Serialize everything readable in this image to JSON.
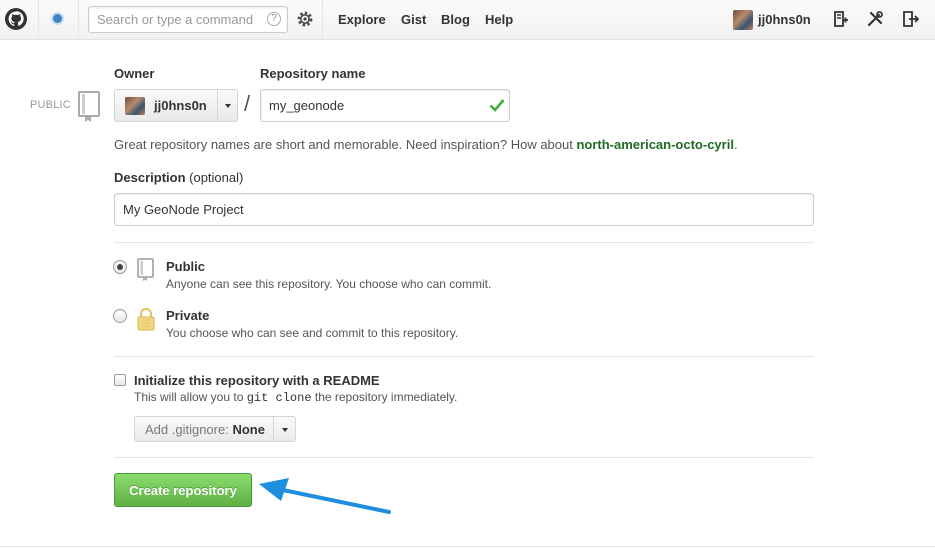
{
  "header": {
    "search_placeholder": "Search or type a command",
    "search_help": "?",
    "nav": [
      "Explore",
      "Gist",
      "Blog",
      "Help"
    ],
    "username": "jj0hns0n"
  },
  "form": {
    "owner_label": "Owner",
    "repo_label": "Repository name",
    "visibility_tag": "PUBLIC",
    "owner_value": "jj0hns0n",
    "slash": "/",
    "repo_value": "my_geonode",
    "hint_text": "Great repository names are short and memorable. Need inspiration? How about ",
    "hint_suggestion": "north-american-octo-cyril",
    "hint_end": ".",
    "description_label": "Description",
    "description_optional": "(optional)",
    "description_value": "My GeoNode Project",
    "visibility": {
      "selected": "public",
      "public_title": "Public",
      "public_desc": "Anyone can see this repository. You choose who can commit.",
      "private_title": "Private",
      "private_desc": "You choose who can see and commit to this repository."
    },
    "init": {
      "title": "Initialize this repository with a README",
      "desc_before": "This will allow you to ",
      "desc_code": "git clone",
      "desc_after": " the repository immediately.",
      "checked": false
    },
    "gitignore": {
      "label": "Add .gitignore:",
      "value": "None"
    },
    "create_button": "Create repository"
  },
  "colors": {
    "accent": "#4183c4",
    "suggestion": "#1f6b26",
    "create_button": "#60b044",
    "arrow": "#1e8fe0"
  }
}
